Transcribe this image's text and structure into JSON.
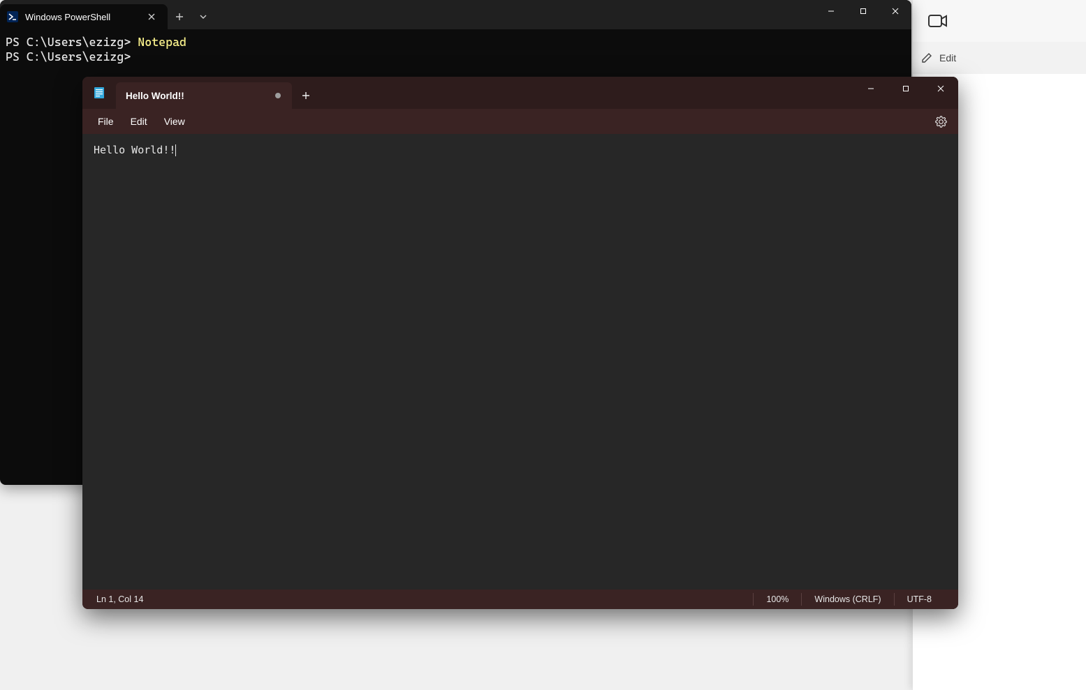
{
  "powershell": {
    "tab_title": "Windows PowerShell",
    "lines": [
      {
        "prompt": "PS C:\\Users\\ezizg> ",
        "command": "Notepad"
      },
      {
        "prompt": "PS C:\\Users\\ezizg> ",
        "command": ""
      }
    ]
  },
  "notepad": {
    "tab_title": "Hello World!!",
    "menu": {
      "file": "File",
      "edit": "Edit",
      "view": "View"
    },
    "content": "Hello World!!",
    "status": {
      "position": "Ln 1, Col 14",
      "zoom": "100%",
      "line_ending": "Windows (CRLF)",
      "encoding": "UTF-8"
    }
  },
  "right_strip": {
    "edit_label": "Edit"
  }
}
